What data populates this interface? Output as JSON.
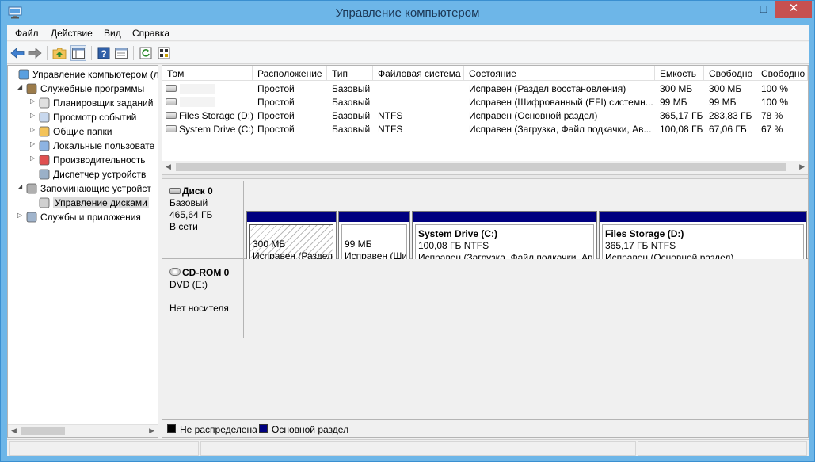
{
  "window": {
    "title": "Управление компьютером",
    "controls": {
      "minimize": "—",
      "maximize": "□",
      "close": "✕"
    }
  },
  "menu": [
    "Файл",
    "Действие",
    "Вид",
    "Справка"
  ],
  "toolbar": {
    "icons": [
      "back-icon",
      "forward-icon",
      "up-folder-icon",
      "show-hide-tree-icon",
      "help-icon",
      "properties-icon",
      "refresh-icon",
      "export-icon"
    ]
  },
  "tree": [
    {
      "label": "Управление компьютером (л",
      "level": 0,
      "expander": "",
      "icon": "computer-management-icon"
    },
    {
      "label": "Служебные программы",
      "level": 1,
      "expander": "◢",
      "icon": "tools-icon"
    },
    {
      "label": "Планировщик заданий",
      "level": 2,
      "expander": "▷",
      "icon": "clock-icon"
    },
    {
      "label": "Просмотр событий",
      "level": 2,
      "expander": "▷",
      "icon": "event-viewer-icon"
    },
    {
      "label": "Общие папки",
      "level": 2,
      "expander": "▷",
      "icon": "shared-folder-icon"
    },
    {
      "label": "Локальные пользовате",
      "level": 2,
      "expander": "▷",
      "icon": "users-icon"
    },
    {
      "label": "Производительность",
      "level": 2,
      "expander": "▷",
      "icon": "performance-icon"
    },
    {
      "label": "Диспетчер устройств",
      "level": 2,
      "expander": "",
      "icon": "device-manager-icon"
    },
    {
      "label": "Запоминающие устройст",
      "level": 1,
      "expander": "◢",
      "icon": "storage-icon"
    },
    {
      "label": "Управление дисками",
      "level": 2,
      "expander": "",
      "icon": "disk-management-icon",
      "selected": true
    },
    {
      "label": "Службы и приложения",
      "level": 1,
      "expander": "▷",
      "icon": "services-icon"
    }
  ],
  "volumes": {
    "columns": [
      "Том",
      "Расположение",
      "Тип",
      "Файловая система",
      "Состояние",
      "Емкость",
      "Свободно",
      "Свободно"
    ],
    "rows": [
      [
        "",
        "Простой",
        "Базовый",
        "",
        "Исправен (Раздел восстановления)",
        "300 МБ",
        "300 МБ",
        "100 %"
      ],
      [
        "",
        "Простой",
        "Базовый",
        "",
        "Исправен (Шифрованный (EFI) системн...",
        "99 МБ",
        "99 МБ",
        "100 %"
      ],
      [
        "Files Storage (D:)",
        "Простой",
        "Базовый",
        "NTFS",
        "Исправен (Основной раздел)",
        "365,17 ГБ",
        "283,83 ГБ",
        "78 %"
      ],
      [
        "System Drive (C:)",
        "Простой",
        "Базовый",
        "NTFS",
        "Исправен (Загрузка, Файл подкачки, Ав...",
        "100,08 ГБ",
        "67,06 ГБ",
        "67 %"
      ]
    ]
  },
  "disks": [
    {
      "name": "Диск 0",
      "type": "Базовый",
      "size": "465,64 ГБ",
      "status": "В сети",
      "partitions": [
        {
          "name": "",
          "size": "300 МБ",
          "status": "Исправен (Раздел"
        },
        {
          "name": "",
          "size": "99 МБ",
          "status": "Исправен (Ши"
        },
        {
          "name": "System Drive  (C:)",
          "size": "100,08 ГБ NTFS",
          "status": "Исправен (Загрузка, Файл подкачки, Ав"
        },
        {
          "name": "Files Storage  (D:)",
          "size": "365,17 ГБ NTFS",
          "status": "Исправен (Основной раздел)"
        }
      ]
    },
    {
      "name": "CD-ROM 0",
      "type": "DVD (E:)",
      "size": "",
      "status": "Нет носителя"
    }
  ],
  "legend": [
    {
      "label": "Не распределена",
      "color": "#000000"
    },
    {
      "label": "Основной раздел",
      "color": "#000080"
    }
  ]
}
